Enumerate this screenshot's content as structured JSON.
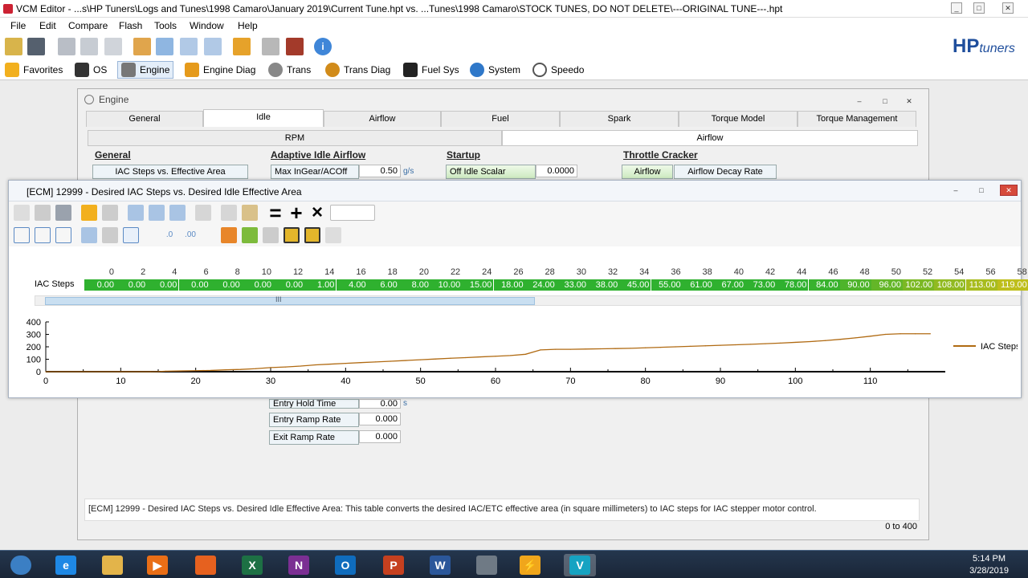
{
  "window_title": "VCM Editor - ...s\\HP Tuners\\Logs and Tunes\\1998 Camaro\\January 2019\\Current Tune.hpt vs. ...Tunes\\1998 Camaro\\STOCK TUNES, DO NOT DELETE\\---ORIGINAL TUNE---.hpt",
  "menu": [
    "File",
    "Edit",
    "Compare",
    "Flash",
    "Tools",
    "Window",
    "Help"
  ],
  "logo": {
    "main": "HP",
    "sub": "tuners"
  },
  "nav": [
    {
      "label": "Favorites",
      "icon": "star-icon",
      "color": "#f2b01e"
    },
    {
      "label": "OS",
      "icon": "chip-icon",
      "color": "#333333"
    },
    {
      "label": "Engine",
      "icon": "engine-icon",
      "color": "#666666"
    },
    {
      "label": "Engine Diag",
      "icon": "engine-diag-icon",
      "color": "#e59a1b"
    },
    {
      "label": "Trans",
      "icon": "gear-icon",
      "color": "#777777"
    },
    {
      "label": "Trans Diag",
      "icon": "gear-diag-icon",
      "color": "#d18b1a"
    },
    {
      "label": "Fuel Sys",
      "icon": "fuel-pump-icon",
      "color": "#222222"
    },
    {
      "label": "System",
      "icon": "globe-icon",
      "color": "#2f78c9"
    },
    {
      "label": "Speedo",
      "icon": "speedometer-icon",
      "color": "#555555"
    }
  ],
  "engine_window": {
    "title": "Engine",
    "tabs": [
      "General",
      "Idle",
      "Airflow",
      "Fuel",
      "Spark",
      "Torque Model",
      "Torque Management"
    ],
    "selected_tab": "Idle",
    "subtabs": [
      "RPM",
      "Airflow"
    ],
    "sections": {
      "general": "General",
      "adaptive": "Adaptive Idle Airflow",
      "startup": "Startup",
      "throttle": "Throttle Cracker"
    },
    "buttons": {
      "iac_steps": "IAC Steps vs. Effective Area",
      "max_ingear": "Max InGear/ACOff",
      "off_idle": "Off Idle Scalar",
      "airflow": "Airflow",
      "decay": "Airflow Decay Rate",
      "entry_hold": "Entry Hold Time",
      "entry_ramp": "Entry Ramp Rate",
      "exit_ramp": "Exit Ramp Rate"
    },
    "values": {
      "max_ingear": "0.50",
      "max_ingear_unit": "g/s",
      "off_idle": "0.0000",
      "entry_hold": "0.00",
      "entry_hold_unit": "s",
      "entry_ramp": "0.000",
      "exit_ramp": "0.000"
    },
    "description": "[ECM] 12999 - Desired IAC Steps vs. Desired Idle Effective Area: This table converts the desired IAC/ETC effective area (in square millimeters) to IAC steps for IAC stepper motor control.",
    "range": "0 to 400"
  },
  "iac_window": {
    "title": "[ECM] 12999 - Desired IAC Steps vs. Desired Idle Effective Area",
    "row_label": "IAC Steps",
    "headers": [
      "0",
      "2",
      "4",
      "6",
      "8",
      "10",
      "12",
      "14",
      "16",
      "18",
      "20",
      "22",
      "24",
      "26",
      "28",
      "30",
      "32",
      "34",
      "36",
      "38",
      "40",
      "42",
      "44",
      "46",
      "48",
      "50",
      "52",
      "54",
      "56",
      "58"
    ],
    "cells": [
      "0.00",
      "0.00",
      "0.00",
      "0.00",
      "0.00",
      "0.00",
      "0.00",
      "1.00",
      "4.00",
      "6.00",
      "8.00",
      "10.00",
      "15.00",
      "18.00",
      "24.00",
      "33.00",
      "38.00",
      "45.00",
      "55.00",
      "61.00",
      "67.00",
      "73.00",
      "78.00",
      "84.00",
      "90.00",
      "96.00",
      "102.00",
      "108.00",
      "113.00",
      "119.00"
    ],
    "scroll_glyph": "III"
  },
  "chart_data": {
    "type": "line",
    "series": [
      {
        "name": "IAC Steps",
        "color": "#b06a12",
        "x": [
          0,
          14,
          15,
          16,
          18,
          20,
          22,
          24,
          26,
          28,
          30,
          32,
          34,
          36,
          38,
          40,
          42,
          44,
          46,
          48,
          50,
          52,
          54,
          56,
          58,
          60,
          62,
          64,
          66,
          68,
          70,
          72,
          74,
          76,
          78,
          80,
          82,
          84,
          86,
          88,
          90,
          92,
          94,
          96,
          98,
          100,
          102,
          104,
          106,
          108,
          110,
          112,
          114,
          116,
          118
        ],
        "y": [
          0,
          0,
          1,
          4,
          6,
          8,
          10,
          15,
          18,
          24,
          33,
          38,
          45,
          55,
          61,
          67,
          73,
          78,
          84,
          90,
          96,
          102,
          108,
          113,
          119,
          124,
          130,
          140,
          175,
          180,
          180,
          182,
          184,
          186,
          188,
          192,
          196,
          200,
          204,
          208,
          212,
          216,
          220,
          225,
          230,
          236,
          242,
          250,
          260,
          272,
          285,
          300,
          305,
          305,
          305
        ]
      }
    ],
    "xticks": [
      "0",
      "10",
      "20",
      "30",
      "40",
      "50",
      "60",
      "70",
      "80",
      "90",
      "100",
      "110"
    ],
    "yticks": [
      "0",
      "100",
      "200",
      "300",
      "400"
    ],
    "xlim": [
      0,
      120
    ],
    "ylim": [
      0,
      400
    ],
    "legend": "right"
  },
  "taskbar": {
    "apps": [
      {
        "name": "start",
        "label": "",
        "color": "#3b7fc4"
      },
      {
        "name": "ie",
        "label": "e",
        "color": "#1e88e5"
      },
      {
        "name": "explorer",
        "label": "",
        "color": "#e3b44a"
      },
      {
        "name": "media",
        "label": "▶",
        "color": "#e96e16"
      },
      {
        "name": "firefox",
        "label": "",
        "color": "#e6611f"
      },
      {
        "name": "excel",
        "label": "X",
        "color": "#1d7044"
      },
      {
        "name": "onenote",
        "label": "N",
        "color": "#7b2f93"
      },
      {
        "name": "outlook",
        "label": "O",
        "color": "#0f6cbd"
      },
      {
        "name": "powerpoint",
        "label": "P",
        "color": "#c5401f"
      },
      {
        "name": "word",
        "label": "W",
        "color": "#2b579a"
      },
      {
        "name": "tools",
        "label": "",
        "color": "#6f7a85"
      },
      {
        "name": "hptuners",
        "label": "⚡",
        "color": "#f0a61b"
      },
      {
        "name": "vcm",
        "label": "V",
        "color": "#16a3c2"
      }
    ],
    "time": "5:14 PM",
    "date": "3/28/2019"
  }
}
